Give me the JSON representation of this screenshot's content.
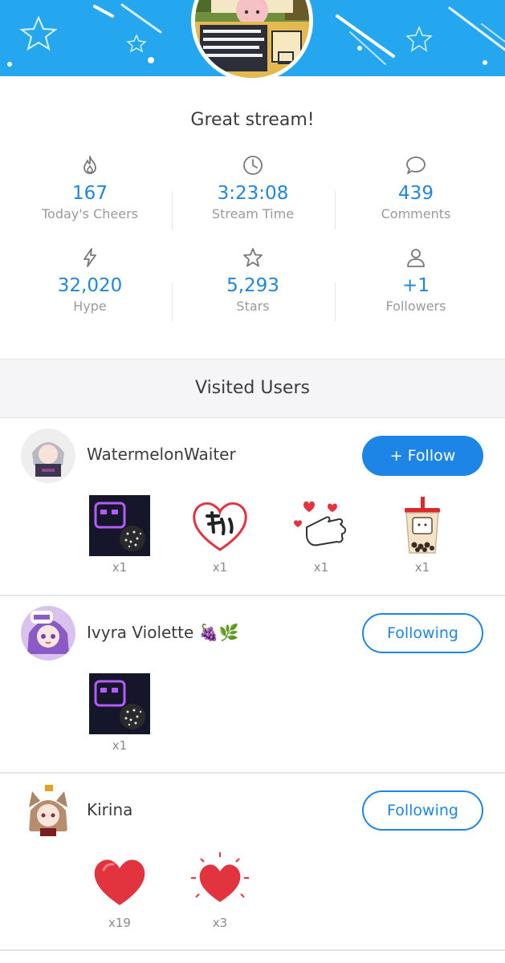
{
  "header": {
    "headline": "Great stream!"
  },
  "stats": [
    {
      "icon": "flame-icon",
      "value": "167",
      "label": "Today's Cheers"
    },
    {
      "icon": "clock-icon",
      "value": "3:23:08",
      "label": "Stream Time"
    },
    {
      "icon": "comment-icon",
      "value": "439",
      "label": "Comments"
    },
    {
      "icon": "lightning-icon",
      "value": "32,020",
      "label": "Hype"
    },
    {
      "icon": "star-icon",
      "value": "5,293",
      "label": "Stars"
    },
    {
      "icon": "person-icon",
      "value": "+1",
      "label": "Followers"
    }
  ],
  "section": {
    "title": "Visited Users"
  },
  "users": [
    {
      "name": "WatermelonWaiter",
      "button": "+ Follow",
      "button_state": "follow",
      "gifts": [
        {
          "icon": "neon-fireworks-gift-icon",
          "count": "x1"
        },
        {
          "icon": "heart-calligraphy-gift-icon",
          "count": "x1"
        },
        {
          "icon": "hand-hearts-gift-icon",
          "count": "x1"
        },
        {
          "icon": "bubble-tea-gift-icon",
          "count": "x1"
        }
      ]
    },
    {
      "name": "Ivyra Violette 🍇🌿",
      "button": "Following",
      "button_state": "following",
      "gifts": [
        {
          "icon": "neon-fireworks-gift-icon",
          "count": "x1"
        }
      ]
    },
    {
      "name": "Kirina",
      "button": "Following",
      "button_state": "following",
      "gifts": [
        {
          "icon": "heart-gift-icon",
          "count": "x19"
        },
        {
          "icon": "sparkle-heart-gift-icon",
          "count": "x3"
        }
      ]
    }
  ],
  "colors": {
    "banner": "#24a7ee",
    "accent": "#1d85e6",
    "stat_value": "#1f86e0",
    "heart": "#e2343f"
  }
}
